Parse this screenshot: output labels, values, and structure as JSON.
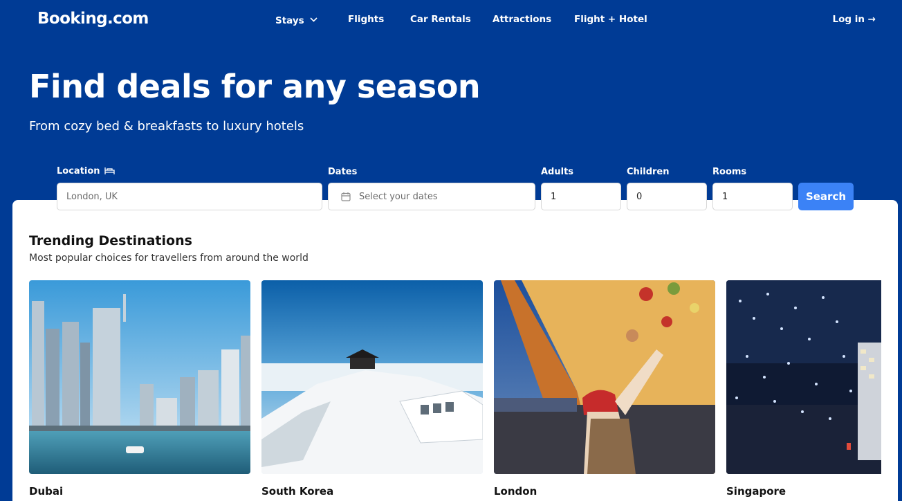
{
  "brand": {
    "logo_text": "Booking.com"
  },
  "nav": {
    "items": [
      {
        "label": "Stays",
        "has_dropdown": true
      },
      {
        "label": "Flights"
      },
      {
        "label": "Car Rentals"
      },
      {
        "label": "Attractions"
      },
      {
        "label": "Flight + Hotel"
      }
    ],
    "login_label": "Log in →"
  },
  "hero": {
    "title": "Find deals for any season",
    "subtitle": "From cozy bed & breakfasts to luxury hotels"
  },
  "search": {
    "location": {
      "label": "Location",
      "placeholder": "London, UK",
      "icon": "bed-icon"
    },
    "dates": {
      "label": "Dates",
      "placeholder": "Select your dates",
      "icon": "calendar-icon"
    },
    "adults": {
      "label": "Adults",
      "value": "1"
    },
    "children": {
      "label": "Children",
      "value": "0"
    },
    "rooms": {
      "label": "Rooms",
      "value": "1"
    },
    "button_label": "Search"
  },
  "trending": {
    "title": "Trending Destinations",
    "subtitle": "Most popular choices for travellers from around the world",
    "destinations": [
      {
        "name": "Dubai"
      },
      {
        "name": "South Korea"
      },
      {
        "name": "London"
      },
      {
        "name": "Singapore"
      }
    ]
  },
  "colors": {
    "brand_blue": "#003b95",
    "search_button": "#3b82f6",
    "panel": "#ffffff"
  }
}
